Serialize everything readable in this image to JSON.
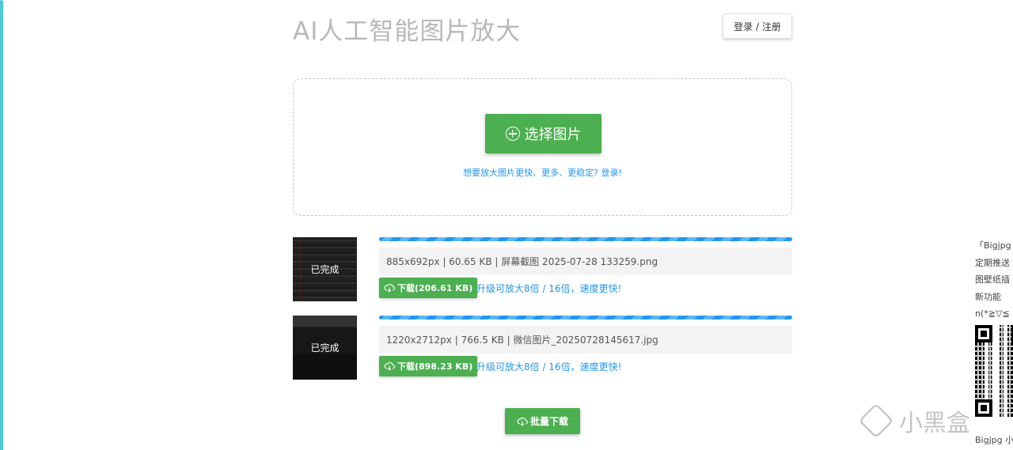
{
  "header": {
    "title": "AI人工智能图片放大",
    "login_label": "登录 / 注册"
  },
  "upload": {
    "select_label": "选择图片",
    "hint": "想要放大图片更快、更多、更稳定? 登录!"
  },
  "files": [
    {
      "status": "已完成",
      "info": "885x692px | 60.65 KB | 屏幕截图 2025-07-28 133259.png",
      "download_label": "下载(206.61 KB)",
      "upgrade_label": "升级可放大8倍 / 16倍，速度更快!",
      "progress": 1.0
    },
    {
      "status": "已完成",
      "info": "1220x2712px | 766.5 KB | 微信图片_20250728145617.jpg",
      "download_label": "下载(898.23 KB)",
      "upgrade_label": "升级可放大8倍 / 16倍，速度更快!",
      "progress": 1.0
    }
  ],
  "batch_download_label": "批量下载",
  "side": {
    "lines": [
      "「Bigjpg",
      "定期推送",
      "图壁纸插",
      "新功能",
      "n(*≧▽≦"
    ],
    "caption": "Bigjpg 小"
  },
  "watermark": "小黑盒",
  "colors": {
    "primary_green": "#4caf50",
    "link_blue": "#2196f3",
    "title_gray": "#b8b8b8"
  }
}
